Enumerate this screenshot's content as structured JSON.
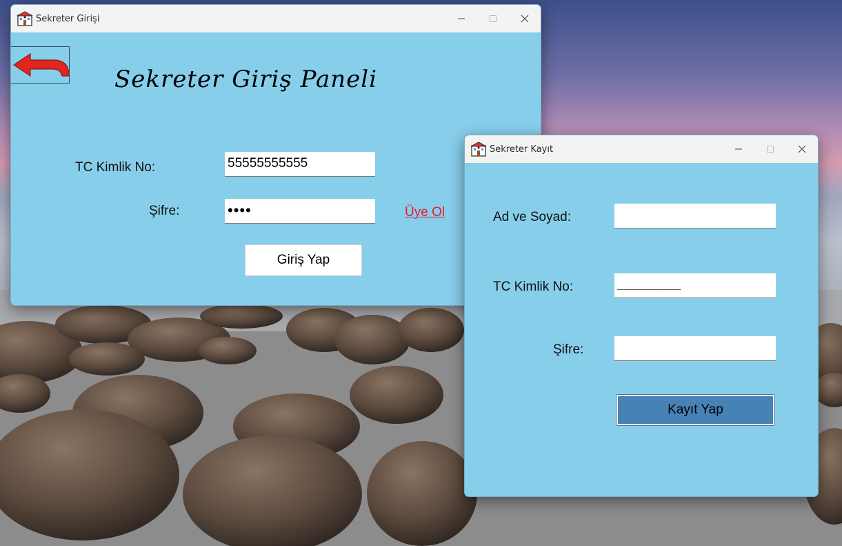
{
  "login_window": {
    "title": "Sekreter Girişi",
    "heading": "Sekreter Giriş Paneli",
    "tc_label": "TC Kimlik No:",
    "tc_value": "55555555555",
    "password_label": "Şifre:",
    "password_value": "••••",
    "register_link": "Üye Ol",
    "login_button": "Giriş Yap",
    "back_icon": "back-arrow-icon"
  },
  "register_window": {
    "title": "Sekreter Kayıt",
    "name_label": "Ad ve Soyad:",
    "name_value": "",
    "tc_label": "TC Kimlik No:",
    "tc_mask": "___________",
    "password_label": "Şifre:",
    "password_value": "",
    "register_button": "Kayıt Yap"
  },
  "titlebar_controls": {
    "minimize": "—",
    "maximize": "☐",
    "close": "✕"
  },
  "colors": {
    "window_bg": "#87ceeb",
    "titlebar_bg": "#f3f3f3",
    "link_red": "#e8192c",
    "kayit_button_bg": "#4682b4",
    "back_arrow": "#e0261e"
  }
}
